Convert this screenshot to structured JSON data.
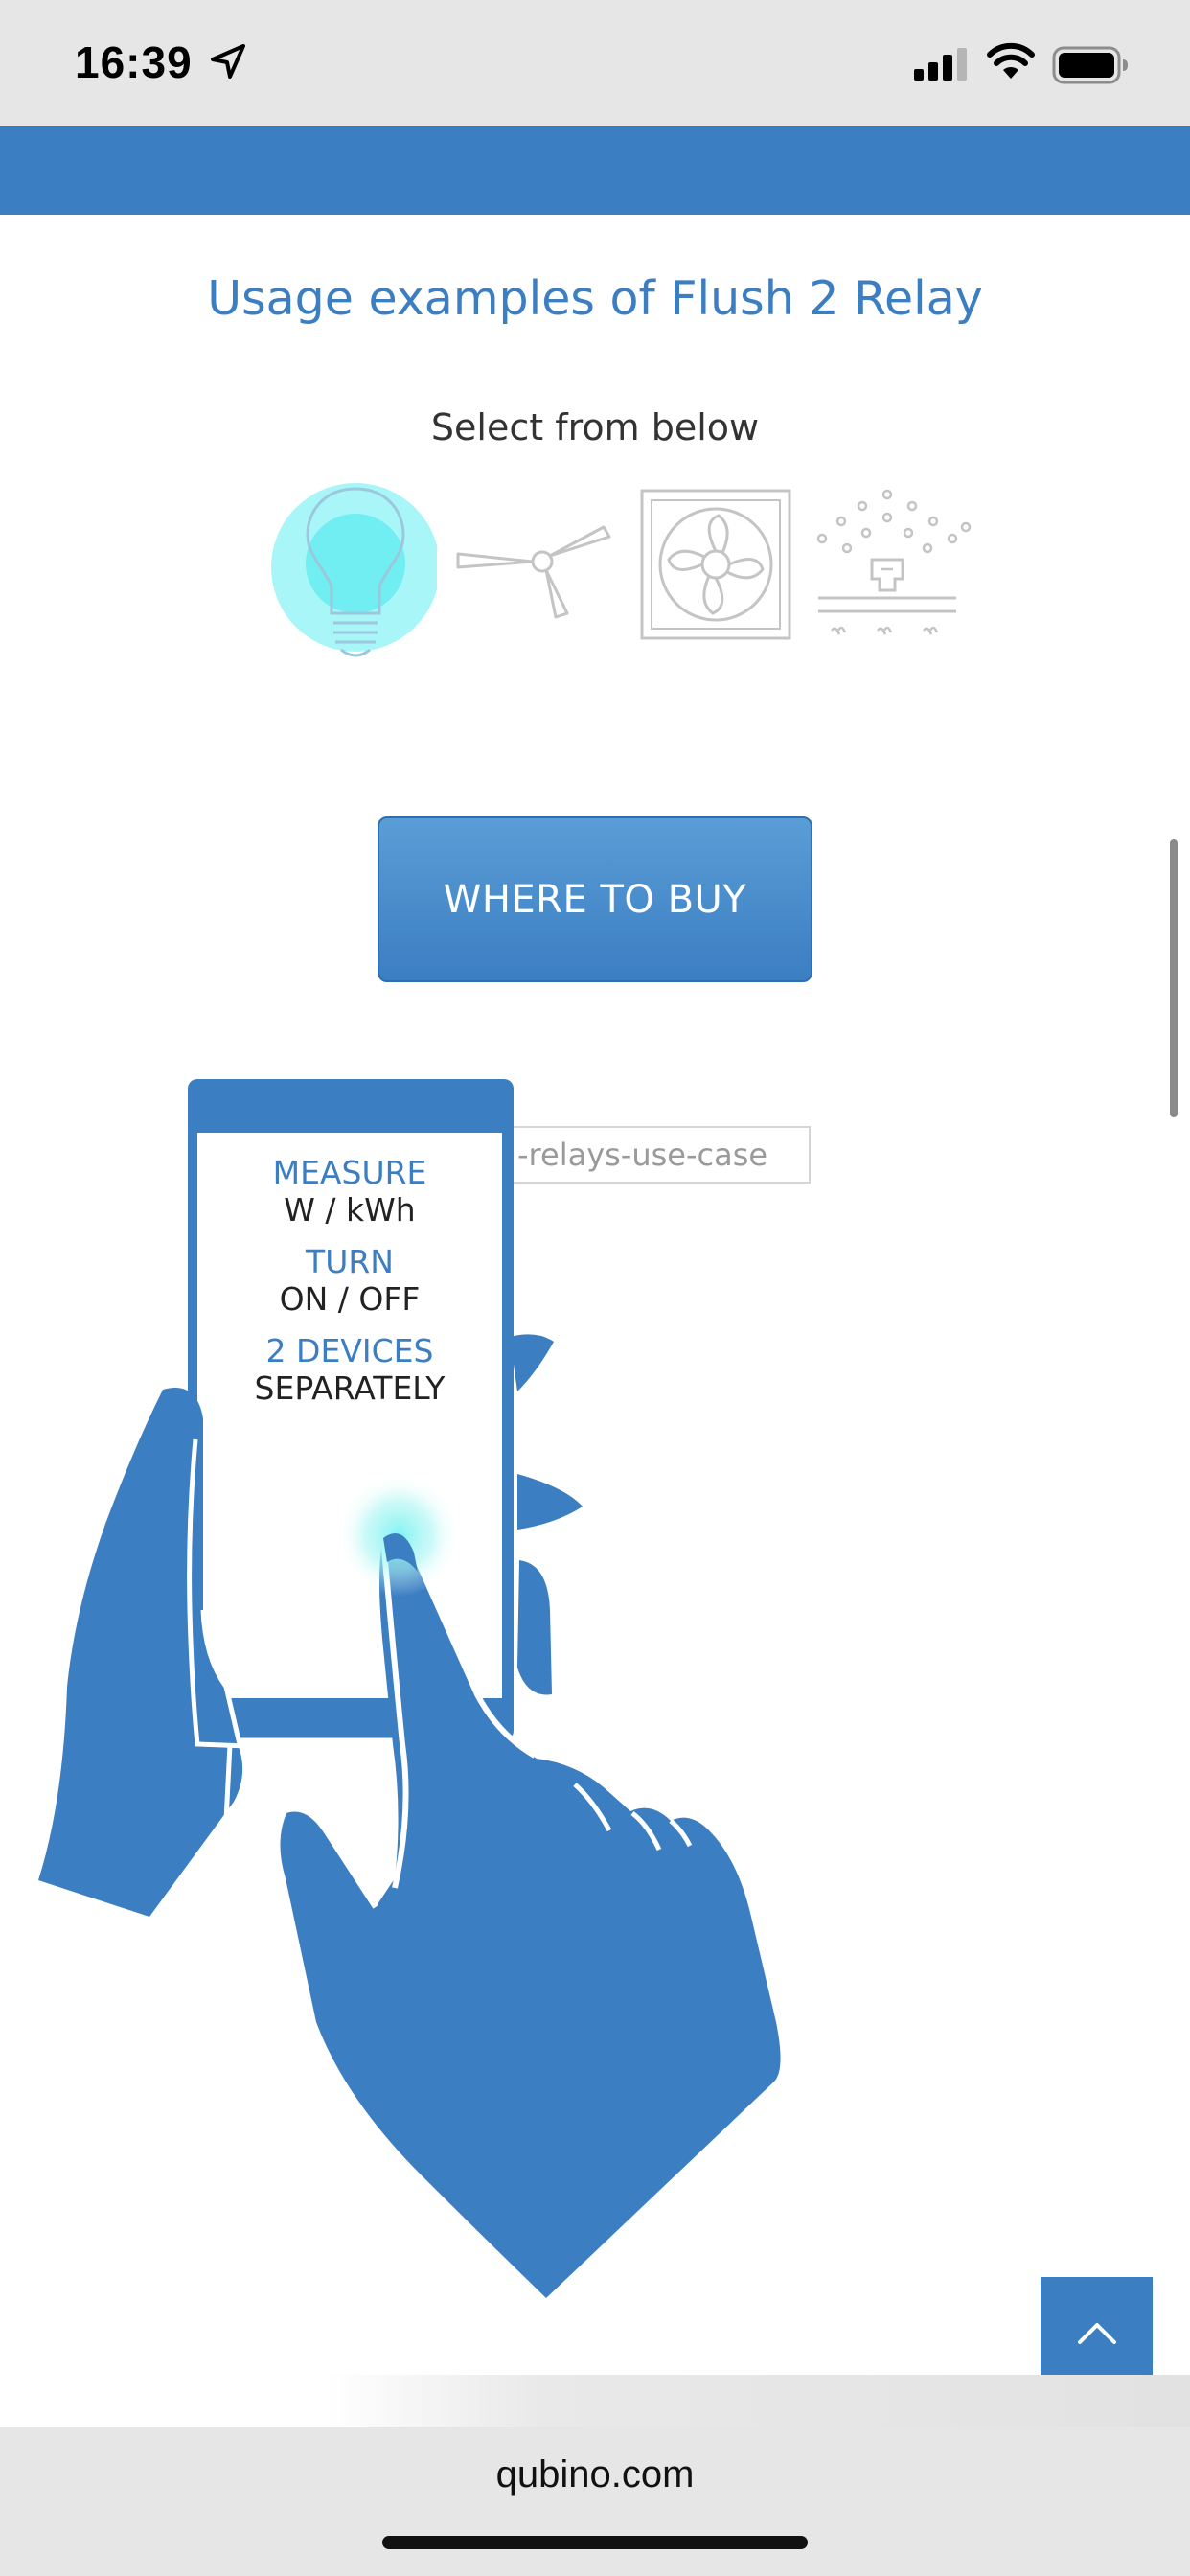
{
  "status_bar": {
    "time": "16:39",
    "icons": [
      "location-arrow-icon",
      "cellular-signal-icon",
      "wifi-icon",
      "battery-icon"
    ]
  },
  "main": {
    "title": "Usage examples of Flush 2 Relay",
    "subtitle": "Select from below",
    "use_cases": [
      {
        "icon": "light-bulb-icon",
        "selected": true
      },
      {
        "icon": "ceiling-fan-icon",
        "selected": false
      },
      {
        "icon": "exhaust-fan-icon",
        "selected": false
      },
      {
        "icon": "sprinkler-icon",
        "selected": false
      }
    ],
    "buy_button": "WHERE TO BUY",
    "broken_image_alt": "-relays-use-case",
    "phone_screen": {
      "line1_label": "MEASURE",
      "line1_value": "W / kWh",
      "line2_label": "TURN",
      "line2_value": "ON / OFF",
      "line3_label": "2 DEVICES",
      "line3_value": "SEPARATELY"
    }
  },
  "browser": {
    "url": "qubino.com"
  },
  "colors": {
    "brand_blue": "#3b7ec2",
    "highlight_cyan": "#7ff3f5"
  }
}
